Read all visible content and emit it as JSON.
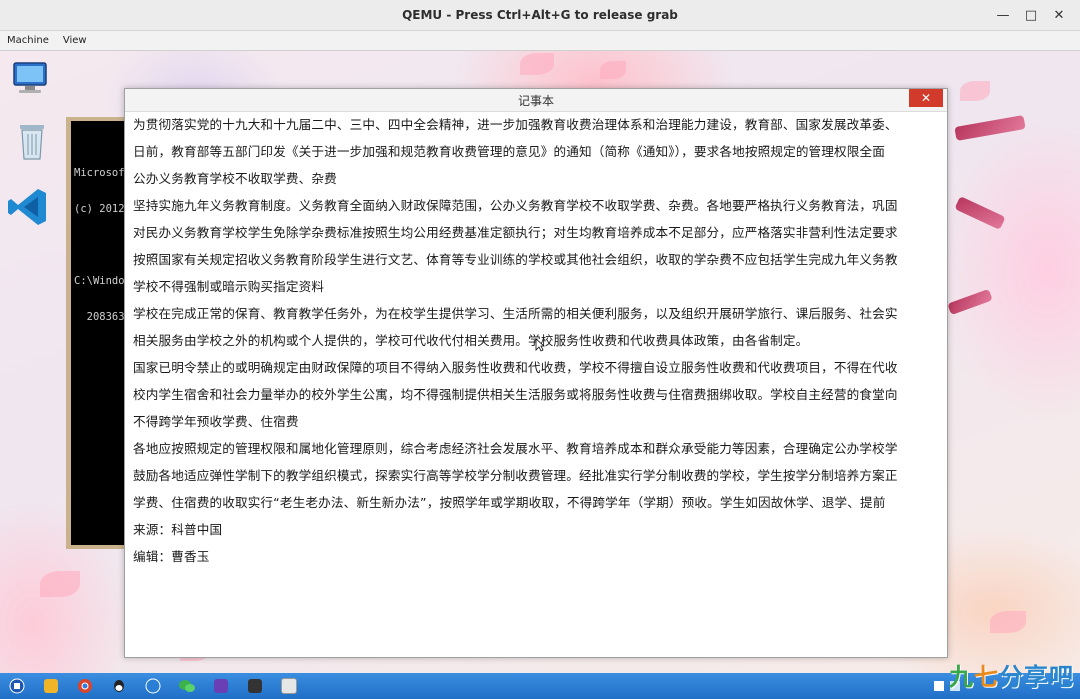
{
  "qemu": {
    "title": "QEMU - Press Ctrl+Alt+G to release grab",
    "menu": [
      "Machine",
      "View"
    ],
    "controls": {
      "minimize": "—",
      "maximize": "□",
      "close": "✕"
    }
  },
  "desktop": {
    "icons": [
      "computer-icon",
      "recycle-bin-icon",
      "vscode-icon"
    ],
    "cmd_window": {
      "lines": [
        "Microsoft",
        "(c) 2012",
        "",
        "C:\\Windo",
        "  208363"
      ]
    }
  },
  "notepad": {
    "title": "记事本",
    "close_label": "✕",
    "lines": [
      "为贯彻落实党的十九大和十九届二中、三中、四中全会精神，进一步加强教育收费治理体系和治理能力建设，教育部、国家发展改革委、",
      "日前，教育部等五部门印发《关于进一步加强和规范教育收费管理的意见》的通知（简称《通知》），要求各地按照规定的管理权限全面",
      "公办义务教育学校不收取学费、杂费",
      "坚持实施九年义务教育制度。义务教育全面纳入财政保障范围，公办义务教育学校不收取学费、杂费。各地要严格执行义务教育法，巩固",
      "对民办义务教育学校学生免除学杂费标准按照生均公用经费基准定额执行；对生均教育培养成本不足部分，应严格落实非营利性法定要求",
      "按照国家有关规定招收义务教育阶段学生进行文艺、体育等专业训练的学校或其他社会组织，收取的学杂费不应包括学生完成九年义务教",
      "学校不得强制或暗示购买指定资料",
      "学校在完成正常的保育、教育教学任务外，为在校学生提供学习、生活所需的相关便利服务，以及组织开展研学旅行、课后服务、社会实",
      "相关服务由学校之外的机构或个人提供的，学校可代收代付相关费用。学校服务性收费和代收费具体政策，由各省制定。",
      "国家已明令禁止的或明确规定由财政保障的项目不得纳入服务性收费和代收费，学校不得擅自设立服务性收费和代收费项目，不得在代收",
      "校内学生宿舍和社会力量举办的校外学生公寓，均不得强制提供相关生活服务或将服务性收费与住宿费捆绑收取。学校自主经营的食堂向",
      "不得跨学年预收学费、住宿费",
      "各地应按照规定的管理权限和属地化管理原则，综合考虑经济社会发展水平、教育培养成本和群众承受能力等因素，合理确定公办学校学",
      "鼓励各地适应弹性学制下的教学组织模式，探索实行高等学校学分制收费管理。经批准实行学分制收费的学校，学生按学分制培养方案正",
      "学费、住宿费的收取实行“老生老办法、新生新办法”，按照学年或学期收取，不得跨学年（学期）预收。学生如因故休学、退学、提前",
      "来源：科普中国",
      "编辑：曹香玉"
    ]
  },
  "taskbar": {
    "items": [
      "start-icon",
      "explorer-icon",
      "chrome-icon",
      "qq-icon",
      "app-icon",
      "wechat-icon",
      "visual-studio-icon",
      "terminal-icon",
      "notepad-icon"
    ],
    "colors": [
      "#1e57b0",
      "#f0b429",
      "#d9452c",
      "#222222",
      "#2a7fd4",
      "#3cb34a",
      "#6a3fb5",
      "#333333",
      "#e6e6e6"
    ]
  },
  "watermark": {
    "part1": "九",
    "part2": "七",
    "part3": "分享吧"
  }
}
